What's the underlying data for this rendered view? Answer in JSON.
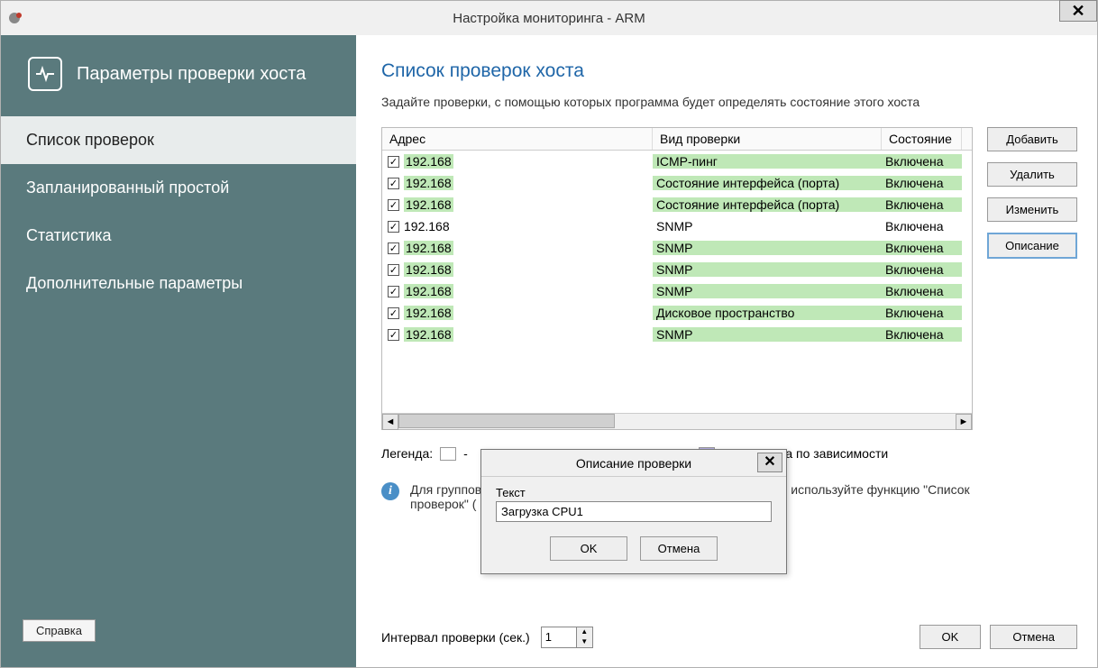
{
  "window": {
    "title": "Настройка мониторинга - ARM"
  },
  "sidebar": {
    "header": "Параметры проверки хоста",
    "items": [
      {
        "label": "Список проверок",
        "active": true
      },
      {
        "label": "Запланированный простой",
        "active": false
      },
      {
        "label": "Статистика",
        "active": false
      },
      {
        "label": "Дополнительные параметры",
        "active": false
      }
    ],
    "help": "Справка"
  },
  "main": {
    "title": "Список проверок хоста",
    "desc": "Задайте проверки, с помощью которых программа будет определять состояние этого хоста",
    "columns": {
      "addr": "Адрес",
      "type": "Вид проверки",
      "state": "Состояние"
    },
    "rows": [
      {
        "checked": true,
        "addr": "192.168",
        "type": "ICMP-пинг",
        "state": "Включена",
        "hl": true
      },
      {
        "checked": true,
        "addr": "192.168",
        "type": "Состояние интерфейса (порта)",
        "state": "Включена",
        "hl": true
      },
      {
        "checked": true,
        "addr": "192.168",
        "type": "Состояние интерфейса (порта)",
        "state": "Включена",
        "hl": true
      },
      {
        "checked": true,
        "addr": "192.168",
        "type": "SNMP",
        "state": "Включена",
        "hl": false
      },
      {
        "checked": true,
        "addr": "192.168",
        "type": "SNMP",
        "state": "Включена",
        "hl": true
      },
      {
        "checked": true,
        "addr": "192.168",
        "type": "SNMP",
        "state": "Включена",
        "hl": true
      },
      {
        "checked": true,
        "addr": "192.168",
        "type": "SNMP",
        "state": "Включена",
        "hl": true
      },
      {
        "checked": true,
        "addr": "192.168",
        "type": "Дисковое пространство",
        "state": "Включена",
        "hl": true
      },
      {
        "checked": true,
        "addr": "192.168",
        "type": "SNMP",
        "state": "Включена",
        "hl": true
      }
    ],
    "buttons": {
      "add": "Добавить",
      "del": "Удалить",
      "edit": "Изменить",
      "desc": "Описание"
    },
    "legend": {
      "label": "Легенда:",
      "dash": "-",
      "fail_dep": "- не прошла по зависимости"
    },
    "info": "Для группов                                                                                    е) используйте функцию \"Список проверок\" (",
    "interval": {
      "label": "Интервал проверки (сек.)",
      "value": "1"
    },
    "ok": "OK",
    "cancel": "Отмена"
  },
  "modal": {
    "title": "Описание проверки",
    "field_label": "Текст",
    "field_value": "Загрузка CPU1",
    "ok": "OK",
    "cancel": "Отмена"
  }
}
